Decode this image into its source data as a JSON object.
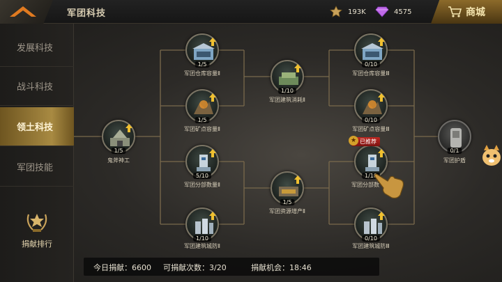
{
  "header": {
    "title": "军团科技"
  },
  "resources": {
    "merit": "193K",
    "gems": "4575"
  },
  "shop": {
    "label": "商城"
  },
  "sidebar": {
    "tabs": [
      {
        "label": "发展科技",
        "active": false
      },
      {
        "label": "战斗科技",
        "active": false
      },
      {
        "label": "领土科技",
        "active": true
      },
      {
        "label": "军团技能",
        "active": false
      }
    ],
    "donate_rank": "捐献排行"
  },
  "tree": {
    "nodes": [
      {
        "id": "n0",
        "name": "鬼斧神工",
        "level": "1/5",
        "icon": "construction-icon",
        "upgradable": true
      },
      {
        "id": "n1",
        "name": "军团仓库容量Ⅱ",
        "level": "1/5",
        "icon": "warehouse-icon",
        "upgradable": true
      },
      {
        "id": "n2",
        "name": "军团矿点容量Ⅱ",
        "level": "1/5",
        "icon": "mine-icon",
        "upgradable": true
      },
      {
        "id": "n3",
        "name": "军团分部数量Ⅱ",
        "level": "5/10",
        "icon": "branch-tower-icon",
        "upgradable": true
      },
      {
        "id": "n4",
        "name": "军团建筑城防Ⅱ",
        "level": "1/10",
        "icon": "city-defense-icon",
        "upgradable": true
      },
      {
        "id": "n5",
        "name": "军团建筑消耗Ⅱ",
        "level": "1/10",
        "icon": "build-cost-icon",
        "upgradable": true
      },
      {
        "id": "n6",
        "name": "军团资源增产Ⅱ",
        "level": "1/5",
        "icon": "resource-boost-icon",
        "upgradable": true
      },
      {
        "id": "n7",
        "name": "军团仓库容量Ⅲ",
        "level": "0/10",
        "icon": "warehouse-icon",
        "upgradable": true
      },
      {
        "id": "n8",
        "name": "军团矿点容量Ⅲ",
        "level": "0/10",
        "icon": "mine-icon",
        "upgradable": true
      },
      {
        "id": "n9",
        "name": "军团分部数",
        "level": "1/10",
        "icon": "branch-tower-icon",
        "upgradable": true
      },
      {
        "id": "n10",
        "name": "军团建筑城防Ⅲ",
        "level": "0/10",
        "icon": "city-defense-icon",
        "upgradable": true
      },
      {
        "id": "n11",
        "name": "军团护盾",
        "level": "0/1",
        "icon": "shield-icon",
        "upgradable": false
      }
    ],
    "recommended_badge": "已推荐"
  },
  "footer": {
    "today_donation": "今日捐献：6600",
    "donate_times": "可捐献次数：3/20",
    "donate_chance": "捐献机会：18:46"
  },
  "colors": {
    "accent_gold": "#a88a42",
    "badge_red": "#c02822",
    "upgrade_arrow": "#f0c030"
  }
}
